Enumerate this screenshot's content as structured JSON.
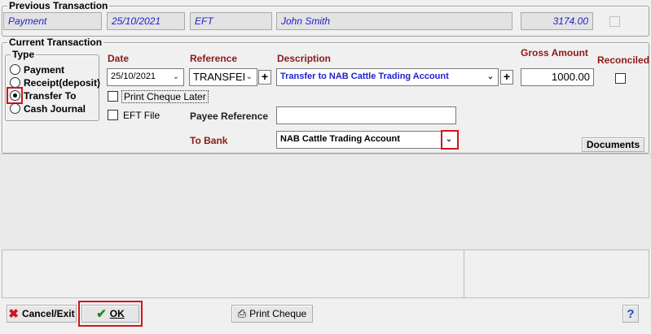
{
  "previous": {
    "title": "Previous Transaction",
    "type": "Payment",
    "date": "25/10/2021",
    "method": "EFT",
    "name": "John Smith",
    "amount": "3174.00"
  },
  "current": {
    "title": "Current Transaction",
    "type_group": {
      "title": "Type",
      "options": [
        "Payment",
        "Receipt(deposit)",
        "Transfer To",
        "Cash Journal"
      ],
      "selected": "Transfer To"
    },
    "labels": {
      "date": "Date",
      "reference": "Reference",
      "description": "Description",
      "gross_amount": "Gross Amount",
      "reconciled": "Reconciled",
      "payee_reference": "Payee Reference",
      "to_bank": "To Bank"
    },
    "values": {
      "date": "25/10/2021",
      "reference": "TRANSFEI",
      "description": "Transfer to NAB Cattle Trading Account",
      "gross_amount": "1000.00",
      "payee_reference": "",
      "to_bank": "NAB Cattle Trading Account"
    },
    "checkboxes": {
      "print_cheque_later": "Print Cheque Later",
      "eft_file": "EFT File"
    },
    "documents_button": "Documents"
  },
  "footer": {
    "cancel_label": "Cancel/Exit",
    "ok_label": "OK",
    "print_cheque_label": "Print Cheque",
    "help_label": "?"
  },
  "colors": {
    "highlight": "#d0141c",
    "label_red": "#8b1a1a",
    "value_blue": "#2020cc"
  }
}
